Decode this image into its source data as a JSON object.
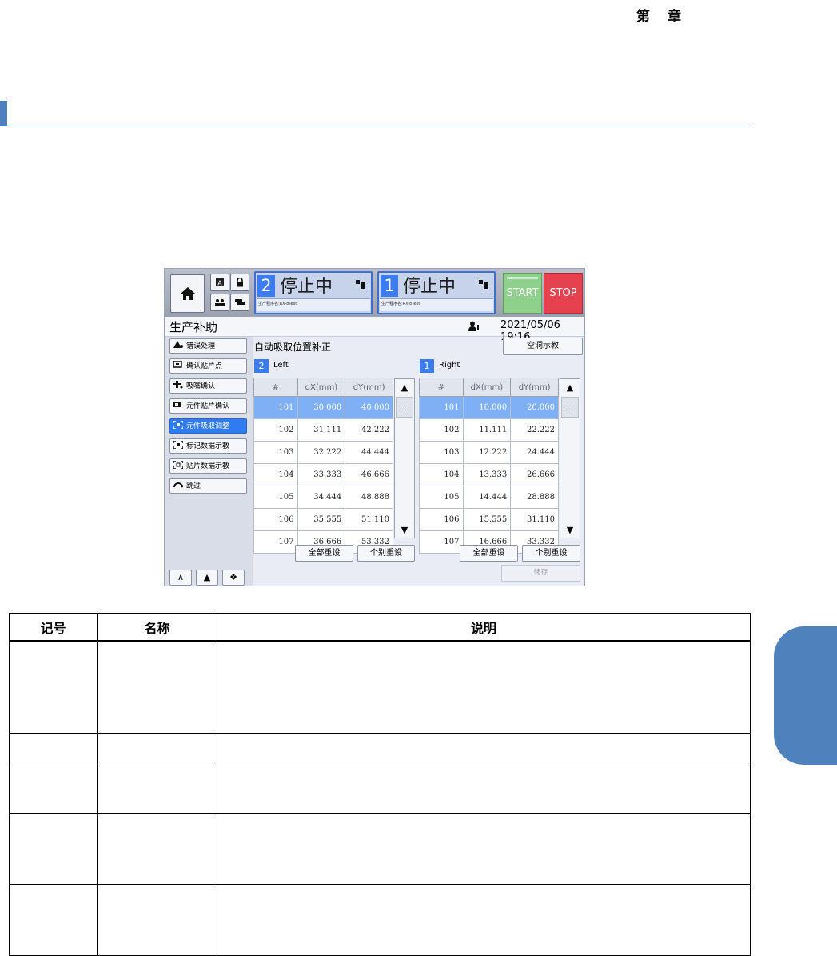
{
  "chapter": {
    "prefix": "第",
    "suffix": "章"
  },
  "screen": {
    "heads": [
      {
        "number": "2",
        "status": "停止中",
        "program": "生产程序名:RX-8Test"
      },
      {
        "number": "1",
        "status": "停止中",
        "program": "生产程序名:RX-8Test"
      }
    ],
    "start_label": "START",
    "stop_label": "STOP",
    "title": "生产补助",
    "datetime": "2021/05/06 19:16",
    "sidebar": [
      {
        "label": "错误处理",
        "icon": "error-handling-icon"
      },
      {
        "label": "确认贴片点",
        "icon": "confirm-point-icon"
      },
      {
        "label": "吸嘴确认",
        "icon": "nozzle-icon"
      },
      {
        "label": "元件贴片确认",
        "icon": "component-mount-icon"
      },
      {
        "label": "元件吸取调整",
        "icon": "pickup-adjust-icon",
        "active": true
      },
      {
        "label": "标记数据示教",
        "icon": "mark-teach-icon"
      },
      {
        "label": "贴片数据示教",
        "icon": "mount-teach-icon"
      },
      {
        "label": "跳过",
        "icon": "skip-icon"
      }
    ],
    "main_title": "自动吸取位置补正",
    "teach_button": "空洞示教",
    "columns": [
      "#",
      "dX(mm)",
      "dY(mm)"
    ],
    "left": {
      "head_number": "2",
      "head_name": "Left",
      "rows": [
        [
          "101",
          "30.000",
          "40.000"
        ],
        [
          "102",
          "31.111",
          "42.222"
        ],
        [
          "103",
          "32.222",
          "44.444"
        ],
        [
          "104",
          "33.333",
          "46.666"
        ],
        [
          "105",
          "34.444",
          "48.888"
        ],
        [
          "106",
          "35.555",
          "51.110"
        ],
        [
          "107",
          "36.666",
          "53.332"
        ]
      ]
    },
    "right": {
      "head_number": "1",
      "head_name": "Right",
      "rows": [
        [
          "101",
          "10.000",
          "20.000"
        ],
        [
          "102",
          "11.111",
          "22.222"
        ],
        [
          "103",
          "12.222",
          "24.444"
        ],
        [
          "104",
          "13.333",
          "26.666"
        ],
        [
          "105",
          "14.444",
          "28.888"
        ],
        [
          "106",
          "15.555",
          "31.110"
        ],
        [
          "107",
          "16.666",
          "33.332"
        ]
      ]
    },
    "reset_all": "全部重设",
    "reset_individual": "个别重设",
    "save": "储存"
  },
  "table": {
    "headers": [
      "记号",
      "名称",
      "说明"
    ]
  }
}
